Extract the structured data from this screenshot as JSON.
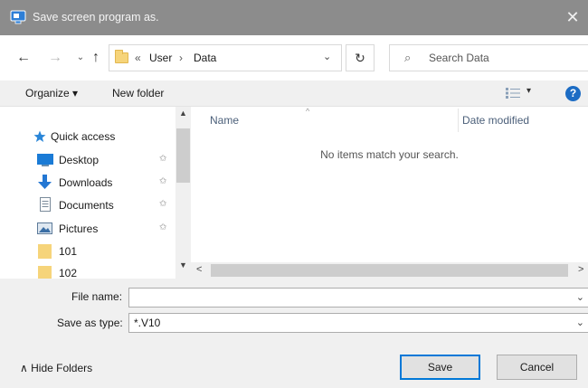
{
  "window": {
    "title": "Save screen program as.",
    "close_glyph": "✕"
  },
  "address": {
    "back_glyph": "←",
    "forward_glyph": "→",
    "recent_glyph": "⌄",
    "up_glyph": "↑",
    "overflow_glyph": "«",
    "crumbs": [
      "User",
      "Data"
    ],
    "crumb_sep": "›",
    "dropdown_glyph": "⌄",
    "refresh_glyph": "↻"
  },
  "search": {
    "placeholder": "Search Data",
    "icon_glyph": "⌕"
  },
  "toolbar": {
    "organize_label": "Organize ▾",
    "new_folder_label": "New folder",
    "view_dropdown_glyph": "▾",
    "help_label": "?"
  },
  "sidebar": {
    "items": [
      {
        "label": "Quick access",
        "icon": "star-icon",
        "pinned": false
      },
      {
        "label": "Desktop",
        "icon": "desktop-icon",
        "pinned": true
      },
      {
        "label": "Downloads",
        "icon": "download-icon",
        "pinned": true
      },
      {
        "label": "Documents",
        "icon": "documents-icon",
        "pinned": true
      },
      {
        "label": "Pictures",
        "icon": "pictures-icon",
        "pinned": true
      },
      {
        "label": "101",
        "icon": "folder-icon",
        "pinned": false
      },
      {
        "label": "102",
        "icon": "folder-icon",
        "pinned": false
      }
    ],
    "pin_glyph": "✩"
  },
  "file_list": {
    "columns": [
      "Name",
      "Date modified"
    ],
    "sort_glyph": "^",
    "empty_message": "No items match your search."
  },
  "scrollbars": {
    "up_glyph": "▲",
    "down_glyph": "▼",
    "left_glyph": "<",
    "right_glyph": ">"
  },
  "form": {
    "file_name_label": "File name:",
    "file_name_value": "",
    "save_as_type_label": "Save as type:",
    "save_as_type_value": "*.V10",
    "chevron_glyph": "⌄"
  },
  "footer": {
    "hide_folders_label": "∧  Hide Folders",
    "save_label": "Save",
    "cancel_label": "Cancel"
  },
  "colors": {
    "titlebar": "#8c8c8c",
    "accent": "#0078d7",
    "help_icon": "#1c6cc4",
    "folder": "#f6d47a"
  }
}
